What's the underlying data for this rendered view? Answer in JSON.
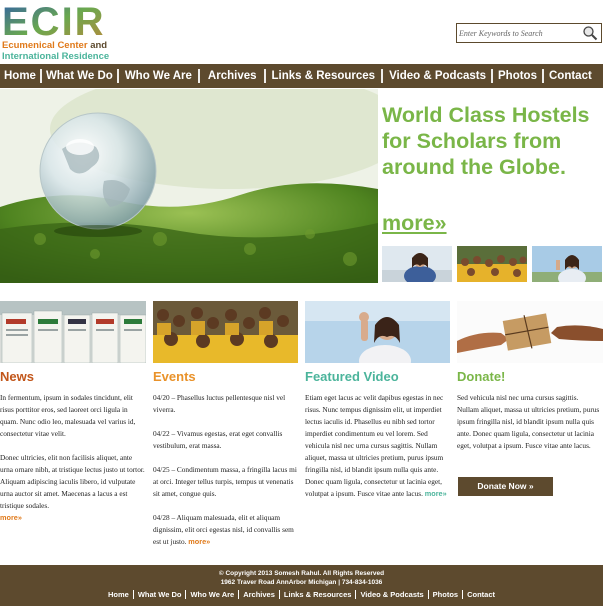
{
  "header": {
    "logo_text": "ECIR",
    "logo_line1_a": "Ecumenical Center",
    "logo_line1_b": "and",
    "logo_line2": "International Residence",
    "search_placeholder": "Enter Keywords to Search"
  },
  "nav": {
    "items": [
      "Home",
      "What We Do",
      "Who We Are",
      "Archives",
      "Links & Resources",
      "Video & Podcasts",
      "Photos",
      "Contact"
    ]
  },
  "hero": {
    "title": "World Class Hostels for Scholars from around the Globe.",
    "more": "more»"
  },
  "columns": {
    "news": {
      "title": "News",
      "paragraphs": [
        "In fermentum, ipsum in sodales tincidunt, elit risus porttitor eros, sed laoreet orci ligula in quam. Nunc odio leo, malesuada vel varius id, consectetur vitae velit.",
        "Donec ultricies, elit non facilisis aliquet, ante urna ornare nibh, at tristique lectus justo ut tortor. Aliquam adipiscing iaculis libero, id vulputate urna auctor sit amet. Maecenas a lacus a est tristique sodales."
      ],
      "more": "more»"
    },
    "events": {
      "title": "Events",
      "items": [
        "04/20 – Phasellus luctus pellentesque nisl vel viverra.",
        "04/22 – Vivamus egestas, erat eget convallis vestibulum, erat massa.",
        "04/25 – Condimentum massa, a fringilla lacus mi at orci. Integer tellus turpis, tempus ut venenatis sit amet, congue quis.",
        "04/28 – Aliquam malesuada, elit et aliquam dignissim, elit orci egestas nisl, id convallis sem est ut justo."
      ],
      "more": "more»"
    },
    "video": {
      "title": "Featured Video",
      "body": "Etiam eget lacus ac velit dapibus egestas in nec risus. Nunc tempus dignissim elit, ut imperdiet lectus iaculis id. Phasellus eu nibh sed tortor imperdiet condimentum eu vel lorem. Sed vehicula nisl nec urna cursus sagittis. Nullam aliquet, massa ut ultricies pretium, purus ipsum fringilla nisl, id blandit ipsum nulla quis ante. Donec quam ligula, consectetur ut lacinia eget, volutpat a ipsum. Fusce vitae ante lacus.",
      "more": "more»"
    },
    "donate": {
      "title": "Donate!",
      "body": "Sed vehicula nisl nec urna cursus sagittis. Nullam aliquet, massa ut ultricies pretium, purus ipsum fringilla nisl, id blandit ipsum nulla quis ante. Donec quam ligula, consectetur ut lacinia eget, volutpat a ipsum. Fusce vitae ante lacus.",
      "button": "Donate Now »"
    }
  },
  "footer": {
    "copyright": "© Copyright 2013 Somesh Rahul. All Rights Reserved",
    "address": "1962 Traver Road AnnArbor Michigan | 734-834-1036",
    "links": [
      "Home",
      "What We Do",
      "Who We Are",
      "Archives",
      "Links & Resources",
      "Video & Podcasts",
      "Photos",
      "Contact"
    ]
  },
  "colors": {
    "brown": "#5d4a2e",
    "green": "#7ab648",
    "orange": "#e07a1b",
    "teal": "#4bb49b",
    "news_title": "#c2561a",
    "events_title": "#e9922a",
    "video_title": "#4bb49b",
    "donate_title": "#7ab648"
  }
}
